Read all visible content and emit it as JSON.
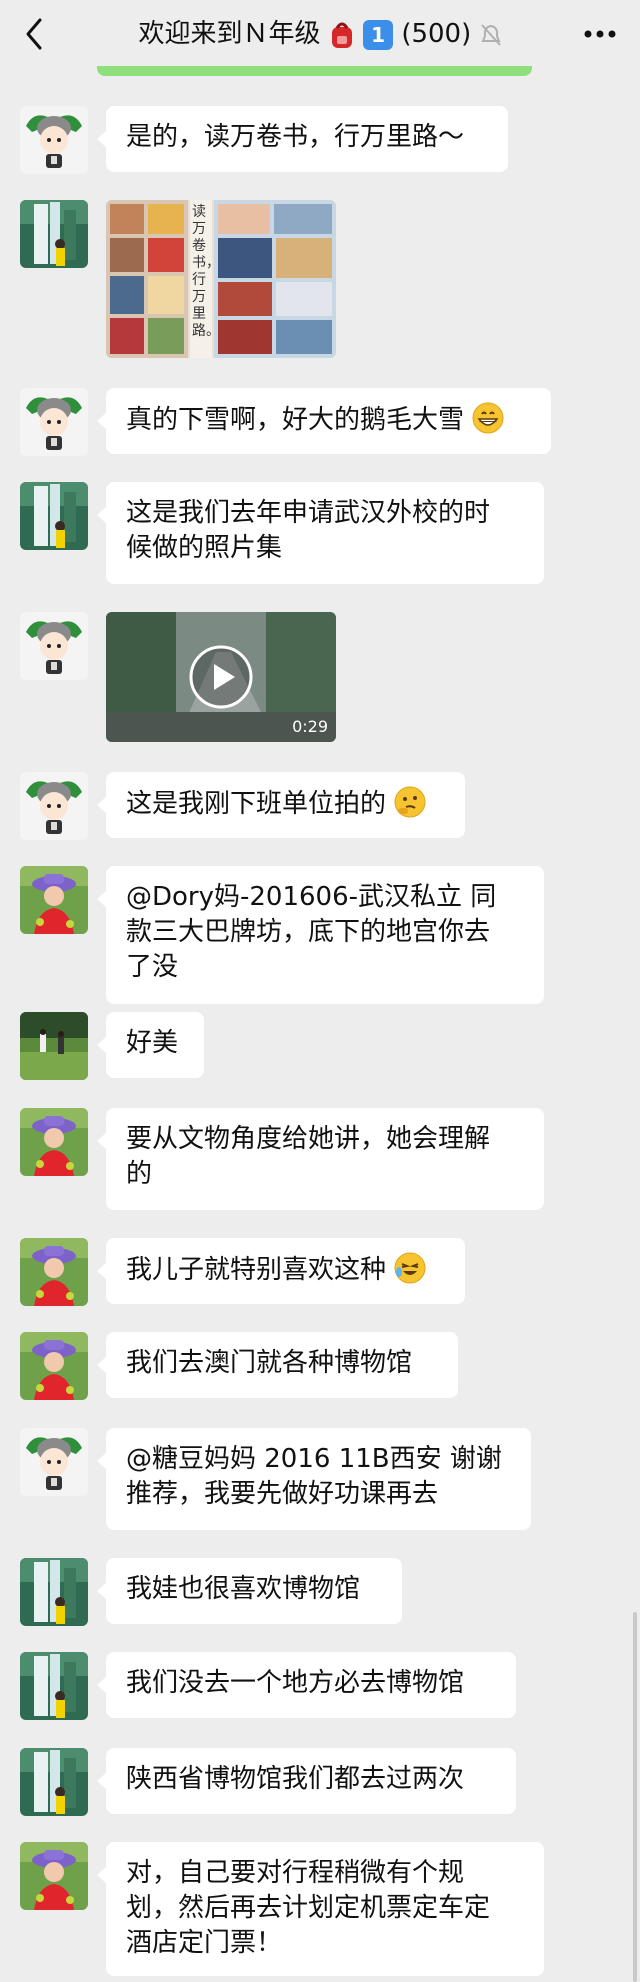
{
  "header": {
    "title_text": "欢迎来到Ｎ年级",
    "badge": "1",
    "member_count": "(500)",
    "back_icon": "chevron-left-icon",
    "more_icon": "more-dots-icon"
  },
  "messages": [
    {
      "avatar": "cartoon-girl-avatar",
      "text": "是的，读万卷书，行万里路～"
    },
    {
      "avatar": "waterfall-avatar",
      "type": "image",
      "image_caption": "读万卷书，行万里路。"
    },
    {
      "avatar": "cartoon-girl-avatar",
      "text": "真的下雪啊，好大的鹅毛大雪"
    },
    {
      "avatar": "waterfall-avatar",
      "text_lines": [
        "这是我们去年申请武汉外校的时",
        "候做的照片集"
      ]
    },
    {
      "avatar": "cartoon-girl-avatar",
      "type": "video",
      "duration": "0:29"
    },
    {
      "avatar": "cartoon-girl-avatar",
      "text": "这是我刚下班单位拍的"
    },
    {
      "avatar": "flower-hat-avatar",
      "text_lines": [
        "@Dory妈-201606-武汉私立 同",
        "款三大巴牌坊，底下的地宫你去",
        "了没"
      ]
    },
    {
      "avatar": "field-avatar",
      "text": "好美"
    },
    {
      "avatar": "flower-hat-avatar",
      "text_lines": [
        "要从文物角度给她讲，她会理解",
        "的"
      ]
    },
    {
      "avatar": "flower-hat-avatar",
      "text": "我儿子就特别喜欢这种"
    },
    {
      "avatar": "flower-hat-avatar",
      "text": "我们去澳门就各种博物馆"
    },
    {
      "avatar": "cartoon-girl-avatar",
      "text_lines": [
        "@糖豆妈妈 2016 11B西安 谢谢",
        "推荐，我要先做好功课再去"
      ]
    },
    {
      "avatar": "waterfall-avatar",
      "text": "我娃也很喜欢博物馆"
    },
    {
      "avatar": "waterfall-avatar",
      "text": "我们没去一个地方必去博物馆"
    },
    {
      "avatar": "waterfall-avatar",
      "text": "陕西省博物馆我们都去过两次"
    },
    {
      "avatar": "flower-hat-avatar",
      "text_lines": [
        "对，自己要对行程稍微有个规",
        "划，然后再去计划定机票定车定",
        "酒店定门票！"
      ]
    }
  ]
}
